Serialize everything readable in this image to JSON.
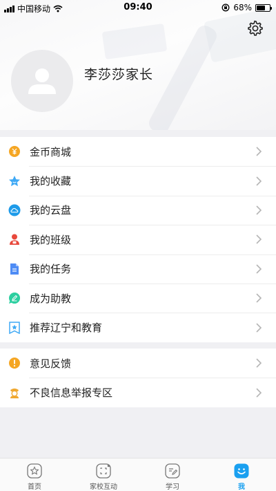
{
  "status_bar": {
    "carrier": "中国移动",
    "time": "09:40",
    "battery": "68%",
    "battery_level": 0.68
  },
  "profile": {
    "name": "李莎莎家长"
  },
  "menu_group_1": [
    {
      "label": "金币商城",
      "icon": "coin-icon",
      "color": "#f5a623"
    },
    {
      "label": "我的收藏",
      "icon": "star-icon",
      "color": "#3fa9f5"
    },
    {
      "label": "我的云盘",
      "icon": "cloud-icon",
      "color": "#1e9be9"
    },
    {
      "label": "我的班级",
      "icon": "class-icon",
      "color": "#e8483c"
    },
    {
      "label": "我的任务",
      "icon": "task-icon",
      "color": "#4e8cf5"
    },
    {
      "label": "成为助教",
      "icon": "edit-icon",
      "color": "#2ccfa0"
    },
    {
      "label": "推荐辽宁和教育",
      "icon": "bookmark-star-icon",
      "color": "#3fa9f5"
    }
  ],
  "menu_group_2": [
    {
      "label": "意见反馈",
      "icon": "feedback-icon",
      "color": "#f5a623"
    },
    {
      "label": "不良信息举报专区",
      "icon": "report-icon",
      "color": "#f0a830"
    }
  ],
  "tabbar": [
    {
      "label": "首页",
      "icon": "home-star-icon"
    },
    {
      "label": "家校互动",
      "icon": "interact-icon"
    },
    {
      "label": "学习",
      "icon": "study-icon"
    },
    {
      "label": "我",
      "icon": "me-icon",
      "active": true
    }
  ],
  "colors": {
    "accent": "#1aa0f0"
  }
}
